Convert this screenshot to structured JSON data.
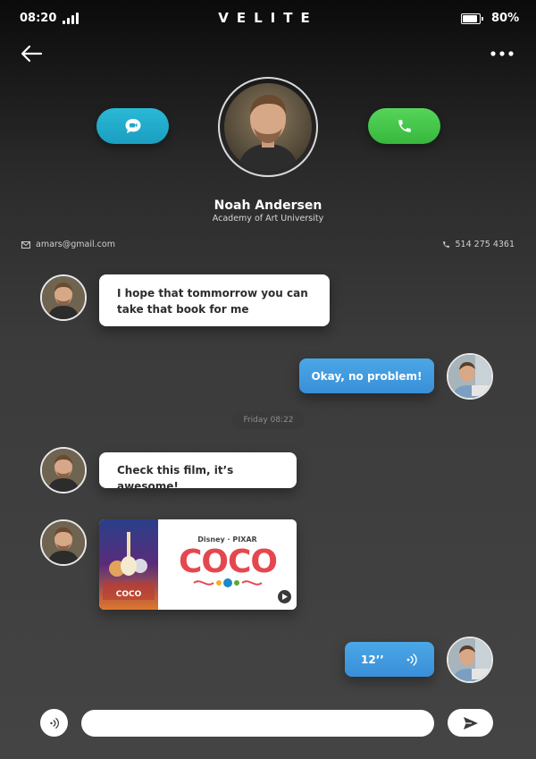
{
  "status_bar": {
    "time": "08:20",
    "battery_percent": "80%",
    "battery_level": 0.8
  },
  "brand": "VELITE",
  "contact": {
    "name": "Noah Andersen",
    "subtitle": "Academy of Art University",
    "email": "amars@gmail.com",
    "phone": "514 275 4361"
  },
  "messages": {
    "m1": "I hope that tommorrow you can take that book for me",
    "m2": "Okay, no problem!",
    "date_separator": "Friday 08:22",
    "m3": "Check this film, it’s awesome!",
    "voice_duration": "12’’"
  },
  "media": {
    "brand_line": "Disney · PIXAR",
    "title": "COCO",
    "poster_title": "COCO"
  },
  "composer": {
    "value": "",
    "placeholder": ""
  },
  "icons": {
    "back": "arrow-left-icon",
    "more": "more-dots-icon",
    "message": "chat-bubble-icon",
    "call": "phone-icon",
    "email": "mail-icon",
    "phone": "phone-small-icon",
    "mic": "voice-wave-icon",
    "send": "send-icon",
    "play": "play-icon"
  },
  "colors": {
    "accent_blue": "#3a8fd8",
    "call_green": "#3fbd43",
    "message_teal": "#22abcb"
  }
}
